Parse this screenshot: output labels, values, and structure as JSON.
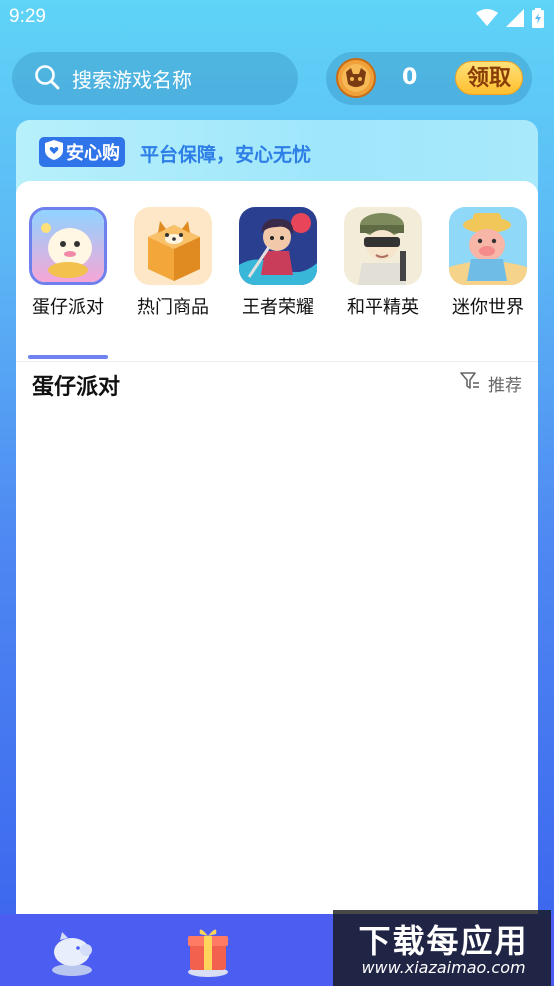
{
  "status_bar": {
    "time": "9:29"
  },
  "search": {
    "placeholder": "搜索游戏名称"
  },
  "coins": {
    "count": "0",
    "claim_label": "领取"
  },
  "banner": {
    "badge_label": "安心购",
    "slogan": "平台保障，安心无忧"
  },
  "categories": [
    {
      "label": "蛋仔派对",
      "icon": "egg-party-game-icon",
      "selected": true
    },
    {
      "label": "热门商品",
      "icon": "shiba-box-icon",
      "selected": false
    },
    {
      "label": "王者荣耀",
      "icon": "honor-of-kings-game-icon",
      "selected": false
    },
    {
      "label": "和平精英",
      "icon": "peacekeeper-elite-game-icon",
      "selected": false
    },
    {
      "label": "迷你世界",
      "icon": "mini-world-game-icon",
      "selected": false
    }
  ],
  "section": {
    "title": "蛋仔派对",
    "sort_label": "推荐"
  },
  "watermark": {
    "title": "下载每应用",
    "url": "www.xiazaimao.com"
  },
  "colors": {
    "accent": "#6f82f0",
    "nav_bg": "#4c5ef2",
    "claim_gold": "#ffbf2e",
    "banner_text": "#2d7ee6"
  }
}
